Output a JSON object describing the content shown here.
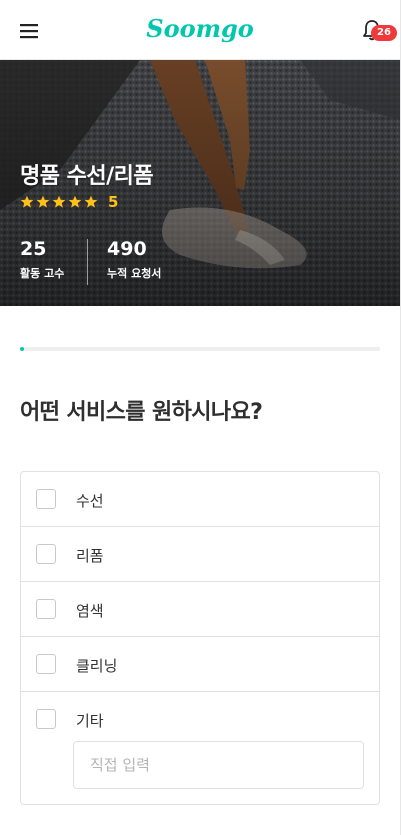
{
  "header": {
    "logo_text": "Soomgo",
    "notification_count": "26",
    "colors": {
      "brand": "#00c7ae",
      "badge": "#f03a3a"
    },
    "icons": [
      "menu-icon",
      "bell-icon"
    ]
  },
  "hero": {
    "title": "명품 수선/리폼",
    "rating_value": "5",
    "star_count": 5,
    "star_color": "#ffc01a",
    "stats": [
      {
        "value": "25",
        "label": "활동 고수"
      },
      {
        "value": "490",
        "label": "누적 요청서"
      }
    ]
  },
  "progress": {
    "percent": 1,
    "color": "#00c7ae"
  },
  "form": {
    "question": "어떤 서비스를 원하시나요?",
    "options": [
      {
        "label": "수선",
        "checked": false
      },
      {
        "label": "리폼",
        "checked": false
      },
      {
        "label": "염색",
        "checked": false
      },
      {
        "label": "클리닝",
        "checked": false
      },
      {
        "label": "기타",
        "checked": false
      }
    ],
    "etc_input_placeholder": "직접 입력",
    "etc_input_value": ""
  }
}
